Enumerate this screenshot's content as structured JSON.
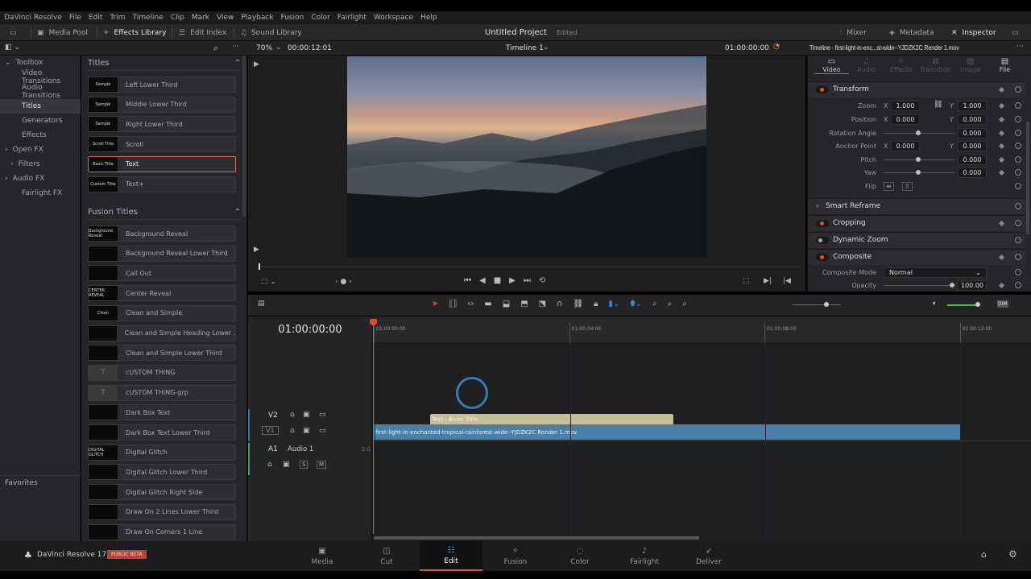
{
  "menu": [
    "DaVinci Resolve",
    "File",
    "Edit",
    "Trim",
    "Timeline",
    "Clip",
    "Mark",
    "View",
    "Playback",
    "Fusion",
    "Color",
    "Fairlight",
    "Workspace",
    "Help"
  ],
  "toolbar": {
    "media_pool": "Media Pool",
    "effects_library": "Effects Library",
    "edit_index": "Edit Index",
    "sound_library": "Sound Library",
    "project_title": "Untitled Project",
    "project_status": "Edited",
    "mixer": "Mixer",
    "metadata": "Metadata",
    "inspector": "Inspector"
  },
  "viewer": {
    "zoom": "70%",
    "duration": "00:00:12:01",
    "timeline_name": "Timeline 1",
    "timecode": "01:00:00:00"
  },
  "sidebar": {
    "items": [
      {
        "label": "Toolbox"
      },
      {
        "label": "Video Transitions"
      },
      {
        "label": "Audio Transitions"
      },
      {
        "label": "Titles"
      },
      {
        "label": "Generators"
      },
      {
        "label": "Effects"
      },
      {
        "label": "Open FX"
      },
      {
        "label": "Filters"
      },
      {
        "label": "Audio FX"
      },
      {
        "label": "Fairlight FX"
      }
    ],
    "favorites": "Favorites"
  },
  "effects": {
    "titles_header": "Titles",
    "titles": [
      {
        "label": "Left Lower Third",
        "thumb": "Sample"
      },
      {
        "label": "Middle Lower Third",
        "thumb": "Sample"
      },
      {
        "label": "Right Lower Third",
        "thumb": "Sample"
      },
      {
        "label": "Scroll",
        "thumb": "Scroll Title"
      },
      {
        "label": "Text",
        "thumb": "Basic Title"
      },
      {
        "label": "Text+",
        "thumb": "Custom Title"
      }
    ],
    "fusion_header": "Fusion Titles",
    "fusion": [
      {
        "label": "Background Reveal",
        "thumb": "Background Reveal"
      },
      {
        "label": "Background Reveal Lower Third",
        "thumb": ""
      },
      {
        "label": "Call Out",
        "thumb": ""
      },
      {
        "label": "Center Reveal",
        "thumb": "CENTER REVEAL"
      },
      {
        "label": "Clean and Simple",
        "thumb": "Clean"
      },
      {
        "label": "Clean and Simple Heading Lower ...",
        "thumb": ""
      },
      {
        "label": "Clean and Simple Lower Third",
        "thumb": ""
      },
      {
        "label": "cUSTOM THING",
        "thumb": "T"
      },
      {
        "label": "cUSTOM THING-grp",
        "thumb": "T"
      },
      {
        "label": "Dark Box Text",
        "thumb": ""
      },
      {
        "label": "Dark Box Text Lower Third",
        "thumb": ""
      },
      {
        "label": "Digital Glitch",
        "thumb": "DIGITAL GLITCH"
      },
      {
        "label": "Digital Glitch Lower Third",
        "thumb": ""
      },
      {
        "label": "Digital Glitch Right Side",
        "thumb": ""
      },
      {
        "label": "Draw On 2 Lines Lower Third",
        "thumb": ""
      },
      {
        "label": "Draw On Corners 1 Line",
        "thumb": ""
      }
    ]
  },
  "inspector": {
    "title": "Timeline - first-light-in-enc...st-wide--YJDZK2C Render 1.mov",
    "tabs": [
      "Video",
      "Audio",
      "Effects",
      "Transition",
      "Image",
      "File"
    ],
    "transform": "Transform",
    "zoom": {
      "label": "Zoom",
      "x": "1.000",
      "y": "1.000"
    },
    "position": {
      "label": "Position",
      "x": "0.000",
      "y": "0.000"
    },
    "rotation": {
      "label": "Rotation Angle",
      "value": "0.000"
    },
    "anchor": {
      "label": "Anchor Point",
      "x": "0.000",
      "y": "0.000"
    },
    "pitch": {
      "label": "Pitch",
      "value": "0.000"
    },
    "yaw": {
      "label": "Yaw",
      "value": "0.000"
    },
    "flip": "Flip",
    "x": "X",
    "y": "Y",
    "smart_reframe": "Smart Reframe",
    "cropping": "Cropping",
    "dynamic_zoom": "Dynamic Zoom",
    "composite": "Composite",
    "composite_mode": {
      "label": "Composite Mode",
      "value": "Normal"
    },
    "opacity": {
      "label": "Opacity",
      "value": "100.00"
    }
  },
  "timeline": {
    "timecode": "01:00:00:00",
    "ruler": [
      "01:00:00:00",
      "01:00:04:00",
      "01:00:08:00",
      "01:00:12:00"
    ],
    "tracks": {
      "v2": "V2",
      "v1": "V1",
      "a1": "A1",
      "a1_name": "Audio 1",
      "a1_channels": "2.0",
      "solo": "S",
      "mute": "M"
    },
    "clips": {
      "title": "Text - Basic Title",
      "video": "first-light-in-enchanted-tropical-rainforest-wide--YJDZK2C Render 1.mov"
    }
  },
  "footer": {
    "app": "DaVinci Resolve 17",
    "badge": "PUBLIC BETA",
    "pages": [
      "Media",
      "Cut",
      "Edit",
      "Fusion",
      "Color",
      "Fairlight",
      "Deliver"
    ]
  },
  "colors": {
    "accent": "#d8544a",
    "clip_video": "#4a7fa8",
    "clip_title": "#c8bd9a"
  }
}
